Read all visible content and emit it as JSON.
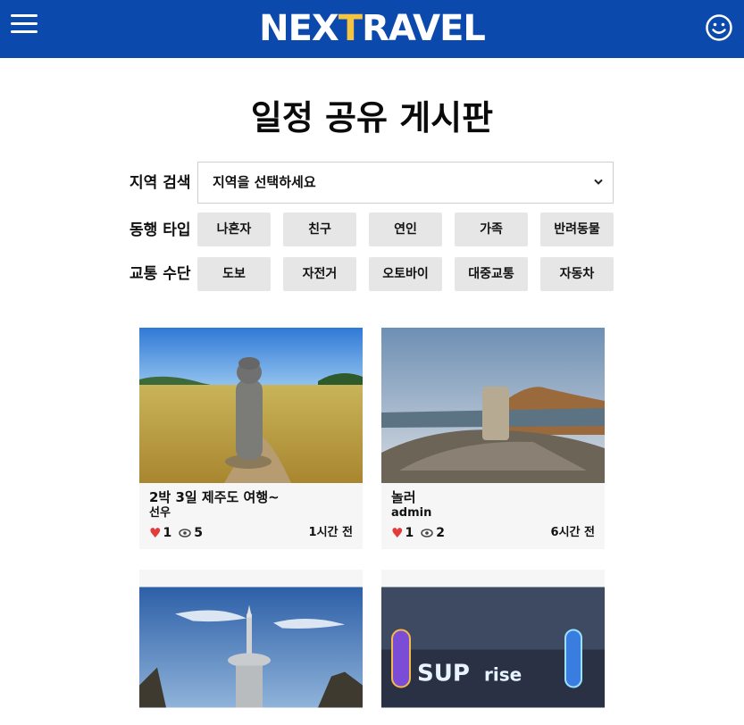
{
  "header": {
    "logo_part1": "NEX",
    "logo_accent": "T",
    "logo_part2": "RAVEL",
    "accent_color": "#f4c542",
    "bar_color": "#0b49ad"
  },
  "page_title": "일정 공유 게시판",
  "filters": {
    "region_label": "지역 검색",
    "region_placeholder": "지역을 선택하세요",
    "companion_label": "동행 타입",
    "companion_options": [
      "나혼자",
      "친구",
      "연인",
      "가족",
      "반려동물"
    ],
    "transport_label": "교통 수단",
    "transport_options": [
      "도보",
      "자전거",
      "오토바이",
      "대중교통",
      "자동차"
    ]
  },
  "posts": [
    {
      "title": "2박 3일 제주도 여행~",
      "author": "선우",
      "likes": "1",
      "views": "5",
      "time": "1시간 전"
    },
    {
      "title": "놀러",
      "author": "admin",
      "likes": "1",
      "views": "2",
      "time": "6시간 전"
    }
  ],
  "icons": {
    "menu": "hamburger-icon",
    "profile": "smiley-icon",
    "dropdown": "chevron-down-icon",
    "like": "heart-icon",
    "view": "eye-icon"
  }
}
